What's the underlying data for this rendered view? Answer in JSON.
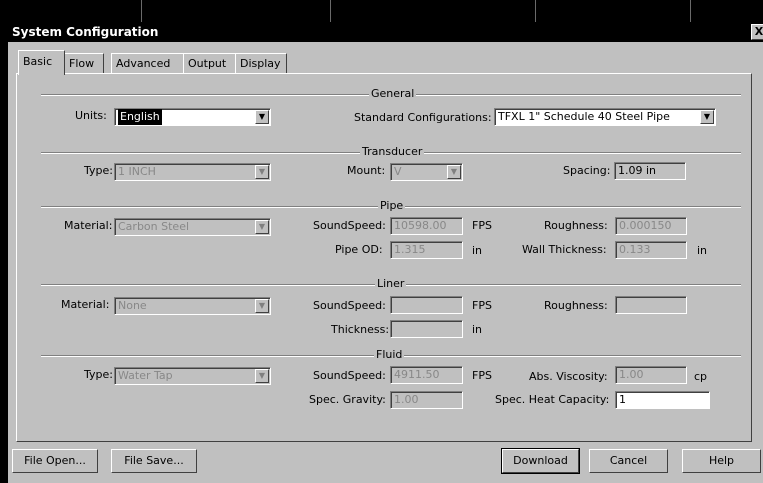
{
  "window": {
    "title": "System Configuration",
    "close": "X"
  },
  "tabs": [
    "Basic",
    "Flow",
    "Advanced",
    "Output",
    "Display"
  ],
  "sections": {
    "general": "General",
    "transducer": "Transducer",
    "pipe": "Pipe",
    "liner": "Liner",
    "fluid": "Fluid"
  },
  "general": {
    "units_label": "Units:",
    "units_value": "English",
    "std_label": "Standard Configurations:",
    "std_value": "TFXL 1\" Schedule 40 Steel Pipe"
  },
  "transducer": {
    "type_label": "Type:",
    "type_value": "1 INCH",
    "mount_label": "Mount:",
    "mount_value": "V",
    "spacing_label": "Spacing:",
    "spacing_value": "1.09 in"
  },
  "pipe": {
    "material_label": "Material:",
    "material_value": "Carbon Steel",
    "sound_label": "SoundSpeed:",
    "sound_value": "10598.00",
    "sound_unit": "FPS",
    "rough_label": "Roughness:",
    "rough_value": "0.000150",
    "od_label": "Pipe OD:",
    "od_value": "1.315",
    "od_unit": "in",
    "wall_label": "Wall Thickness:",
    "wall_value": "0.133",
    "wall_unit": "in"
  },
  "liner": {
    "material_label": "Material:",
    "material_value": "None",
    "sound_label": "SoundSpeed:",
    "sound_value": "",
    "sound_unit": "FPS",
    "rough_label": "Roughness:",
    "rough_value": "",
    "thick_label": "Thickness:",
    "thick_value": "",
    "thick_unit": "in"
  },
  "fluid": {
    "type_label": "Type:",
    "type_value": "Water Tap",
    "sound_label": "SoundSpeed:",
    "sound_value": "4911.50",
    "sound_unit": "FPS",
    "visc_label": "Abs. Viscosity:",
    "visc_value": "1.00",
    "visc_unit": "cp",
    "sg_label": "Spec. Gravity:",
    "sg_value": "1.00",
    "heat_label": "Spec. Heat Capacity:",
    "heat_value": "1"
  },
  "buttons": {
    "file_open": "File Open...",
    "file_save": "File Save...",
    "download": "Download",
    "cancel": "Cancel",
    "help": "Help"
  },
  "icons": {
    "dropdown": "▼"
  }
}
